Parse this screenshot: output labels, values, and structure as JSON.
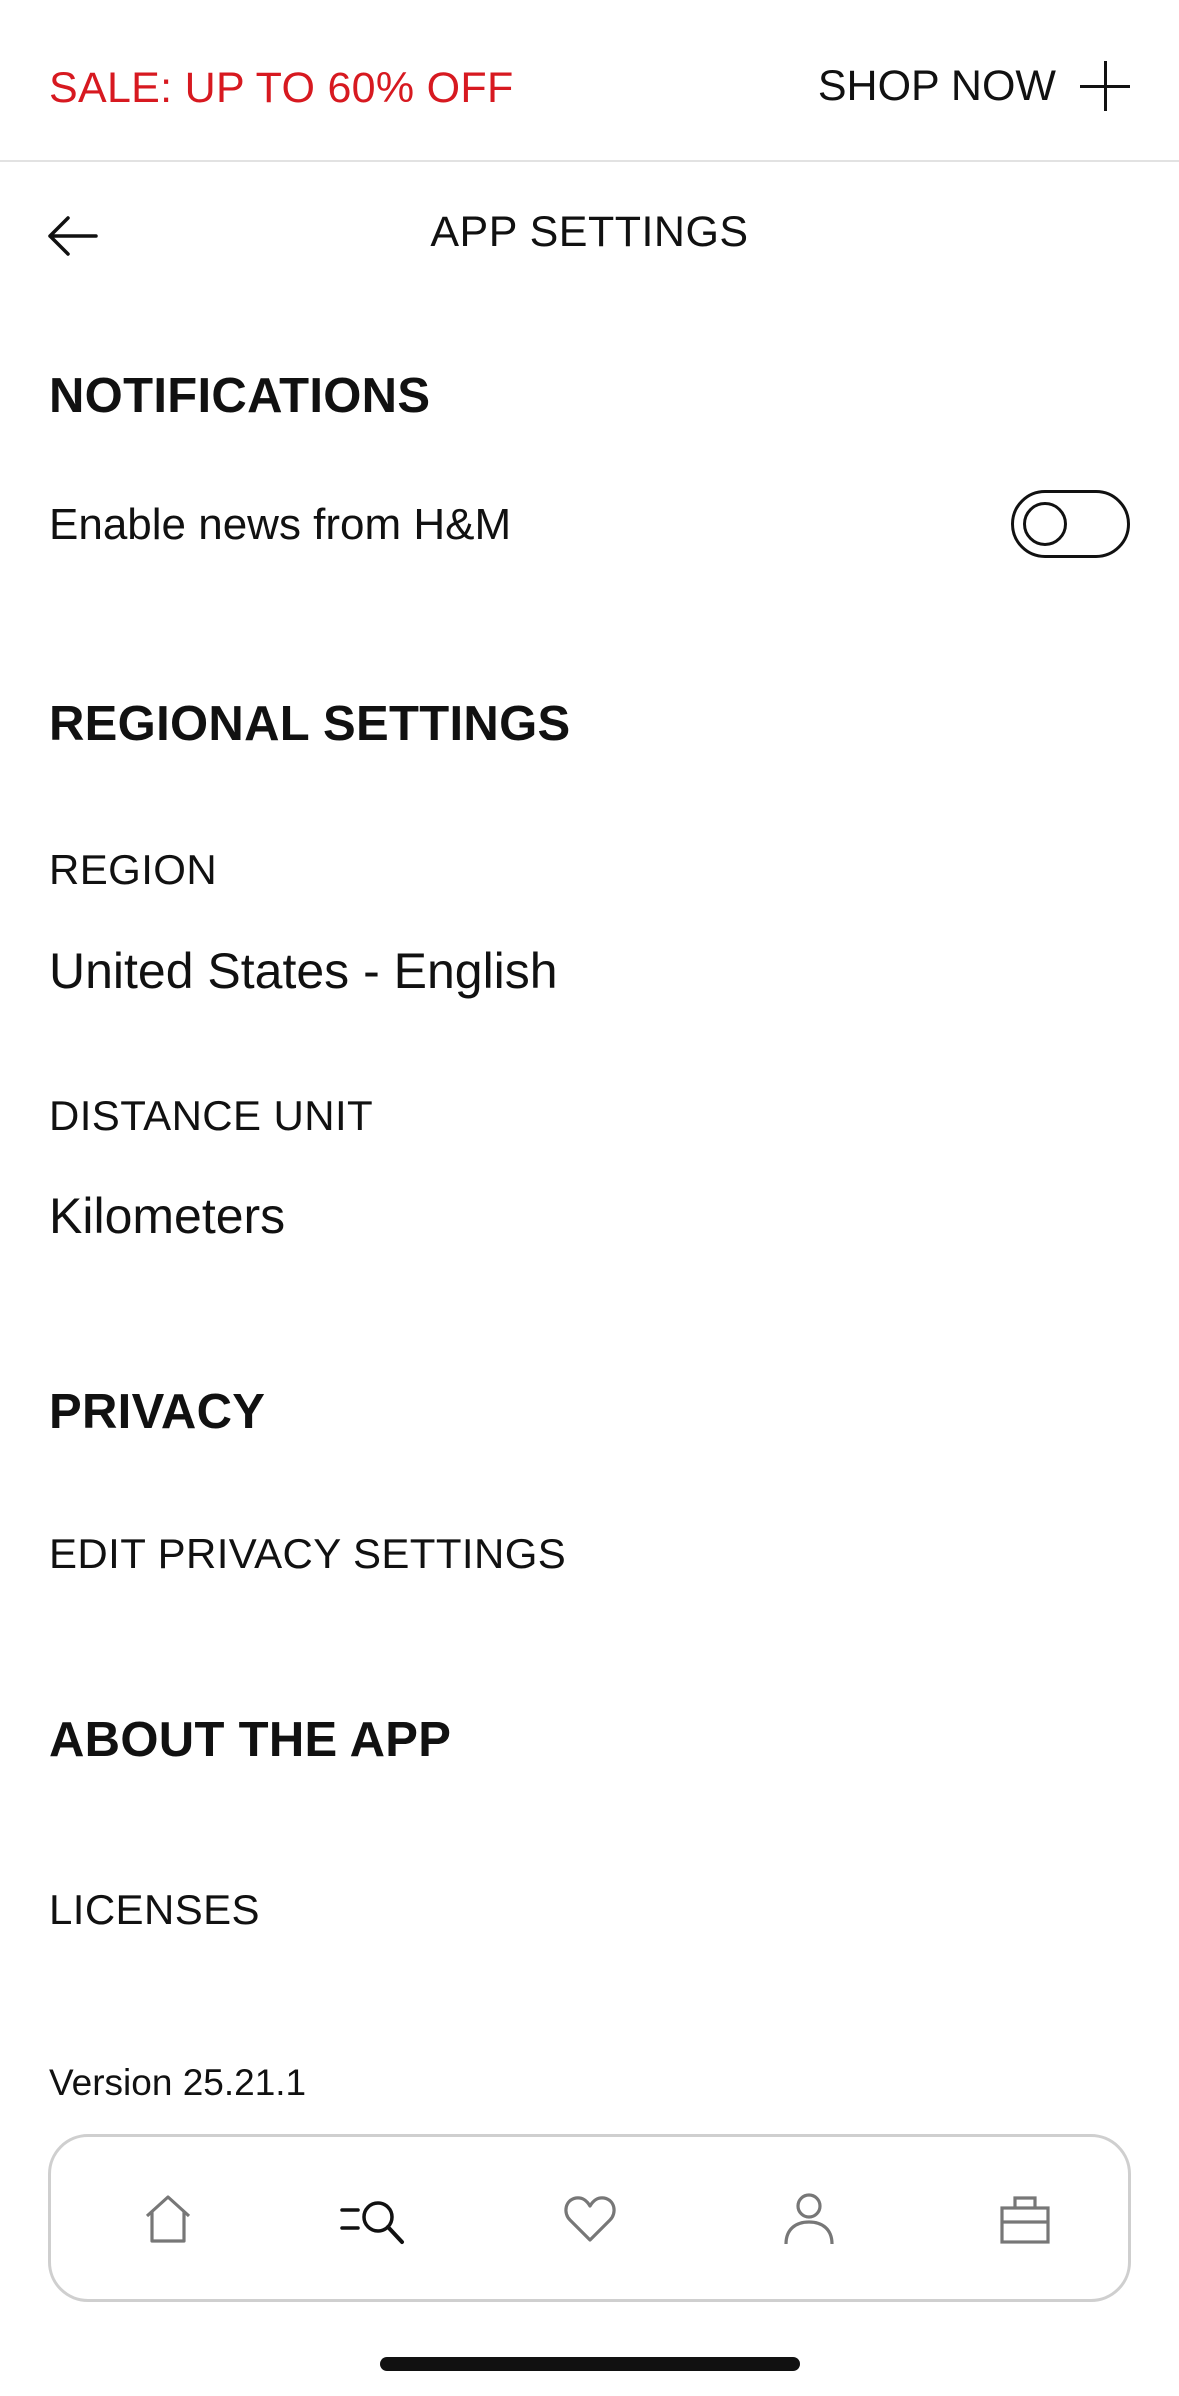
{
  "banner": {
    "sale_text": "SALE: UP TO 60% OFF",
    "shop_label": "SHOP NOW",
    "sale_color": "#d71920"
  },
  "header": {
    "title": "APP SETTINGS",
    "back_icon": "arrow-left-icon"
  },
  "notifications": {
    "heading": "NOTIFICATIONS",
    "news_label": "Enable news from H&M",
    "news_enabled": false
  },
  "regional": {
    "heading": "REGIONAL SETTINGS",
    "region_label": "REGION",
    "region_value": "United States - English",
    "distance_label": "DISTANCE UNIT",
    "distance_value": "Kilometers"
  },
  "privacy": {
    "heading": "PRIVACY",
    "edit_label": "EDIT PRIVACY SETTINGS"
  },
  "about": {
    "heading": "ABOUT THE APP",
    "licenses_label": "LICENSES",
    "version": "Version 25.21.1"
  },
  "tabbar": {
    "items": [
      {
        "icon": "home-icon"
      },
      {
        "icon": "search-icon"
      },
      {
        "icon": "heart-icon"
      },
      {
        "icon": "account-icon"
      },
      {
        "icon": "shopping-bag-icon"
      }
    ]
  }
}
